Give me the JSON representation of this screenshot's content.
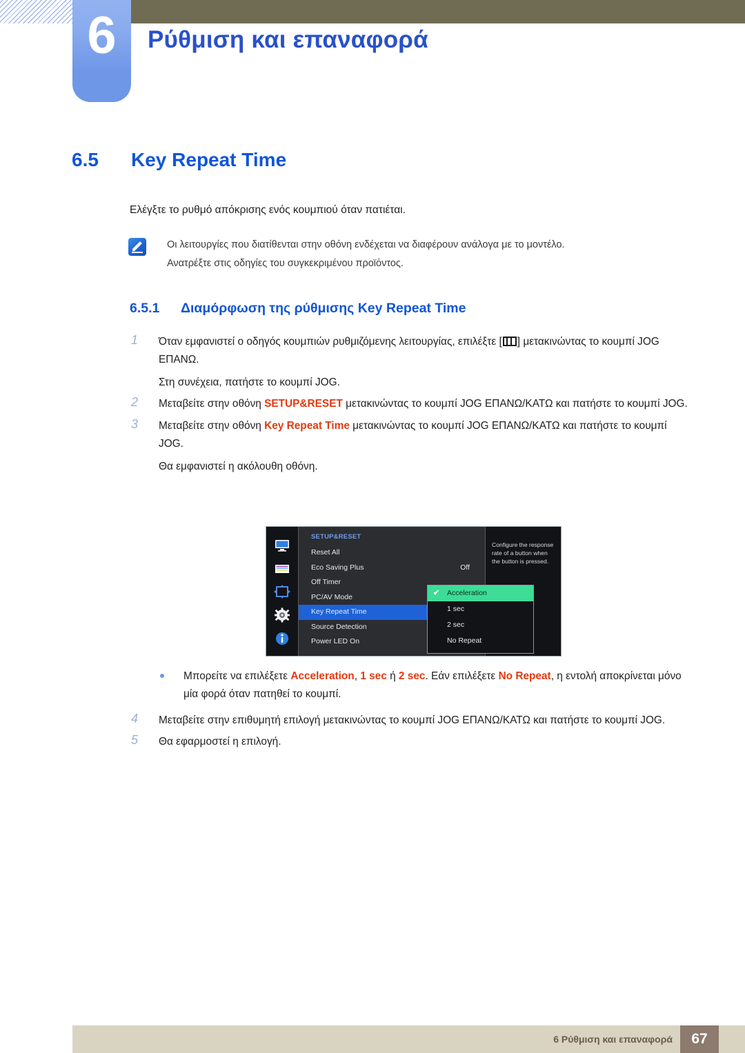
{
  "chapter": {
    "number": "6",
    "title": "Ρύθμιση και επαναφορά"
  },
  "section": {
    "number": "6.5",
    "title": "Key Repeat Time",
    "intro": "Ελέγξτε το ρυθμό απόκρισης ενός κουμπιού όταν πατιέται."
  },
  "note": {
    "icon": "note-pen-icon",
    "line1": "Οι λειτουργίες που διατίθενται στην οθόνη ενδέχεται να διαφέρουν ανάλογα με το μοντέλο.",
    "line2": "Ανατρέξτε στις οδηγίες του συγκεκριμένου προϊόντος."
  },
  "subsection": {
    "number": "6.5.1",
    "title": "Διαμόρφωση της ρύθμισης Key Repeat Time"
  },
  "steps": [
    {
      "num": "1",
      "pre": "Όταν εμφανιστεί ο οδηγός κουμπιών ρυθμιζόμενης λειτουργίας, επιλέξτε [",
      "post": "] μετακινώντας το κουμπί JOG ΕΠΑΝΩ.",
      "sub": "Στη συνέχεια, πατήστε το κουμπί JOG."
    },
    {
      "num": "2",
      "pre": "Μεταβείτε στην οθόνη ",
      "highlight": "SETUP&RESET",
      "post": " μετακινώντας το κουμπί JOG ΕΠΑΝΩ/ΚΑΤΩ και πατήστε το κουμπί JOG."
    },
    {
      "num": "3",
      "pre": "Μεταβείτε στην οθόνη ",
      "highlight": "Key Repeat Time",
      "post": " μετακινώντας το κουμπί JOG ΕΠΑΝΩ/ΚΑΤΩ και πατήστε το κουμπί JOG.",
      "sub": "Θα εμφανιστεί η ακόλουθη οθόνη."
    }
  ],
  "bullet": {
    "pre": "Μπορείτε να επιλέξετε ",
    "opt1": "Acceleration",
    "sep1": ", ",
    "opt2": "1 sec",
    "sep2": " ή ",
    "opt3": "2 sec",
    "mid": ". Εάν επιλέξετε ",
    "opt4": "No Repeat",
    "post": ", η εντολή αποκρίνεται μόνο μία φορά όταν πατηθεί το κουμπί."
  },
  "steps2": [
    {
      "num": "4",
      "text": "Μεταβείτε στην επιθυμητή επιλογή μετακινώντας το κουμπί JOG ΕΠΑΝΩ/ΚΑΤΩ και πατήστε το κουμπί JOG."
    },
    {
      "num": "5",
      "text": "Θα εφαρμοστεί η επιλογή."
    }
  ],
  "osd": {
    "menu_title": "SETUP&RESET",
    "rows": [
      {
        "label": "Reset All",
        "value": ""
      },
      {
        "label": "Eco Saving Plus",
        "value": "Off"
      },
      {
        "label": "Off Timer",
        "value": ""
      },
      {
        "label": "PC/AV Mode",
        "value": ""
      },
      {
        "label": "Key Repeat Time",
        "value": "",
        "selected": true
      },
      {
        "label": "Source Detection",
        "value": ""
      },
      {
        "label": "Power LED On",
        "value": ""
      }
    ],
    "popup_options": [
      {
        "label": "Acceleration",
        "checked": true
      },
      {
        "label": "1 sec",
        "checked": false
      },
      {
        "label": "2 sec",
        "checked": false
      },
      {
        "label": "No Repeat",
        "checked": false
      }
    ],
    "help_text": "Configure the response rate of a button when the button is pressed.",
    "sidebar_icons": [
      "monitor-icon",
      "color-bars-icon",
      "move-arrows-icon",
      "gear-icon",
      "info-icon"
    ],
    "colors": {
      "selected_row": "#1f62d8",
      "checked_option": "#3ddc97",
      "title": "#6f9be8",
      "background": "#121316",
      "panel": "#2b2d31"
    }
  },
  "footer": {
    "text": "6 Ρύθμιση και επαναφορά",
    "page": "67"
  }
}
